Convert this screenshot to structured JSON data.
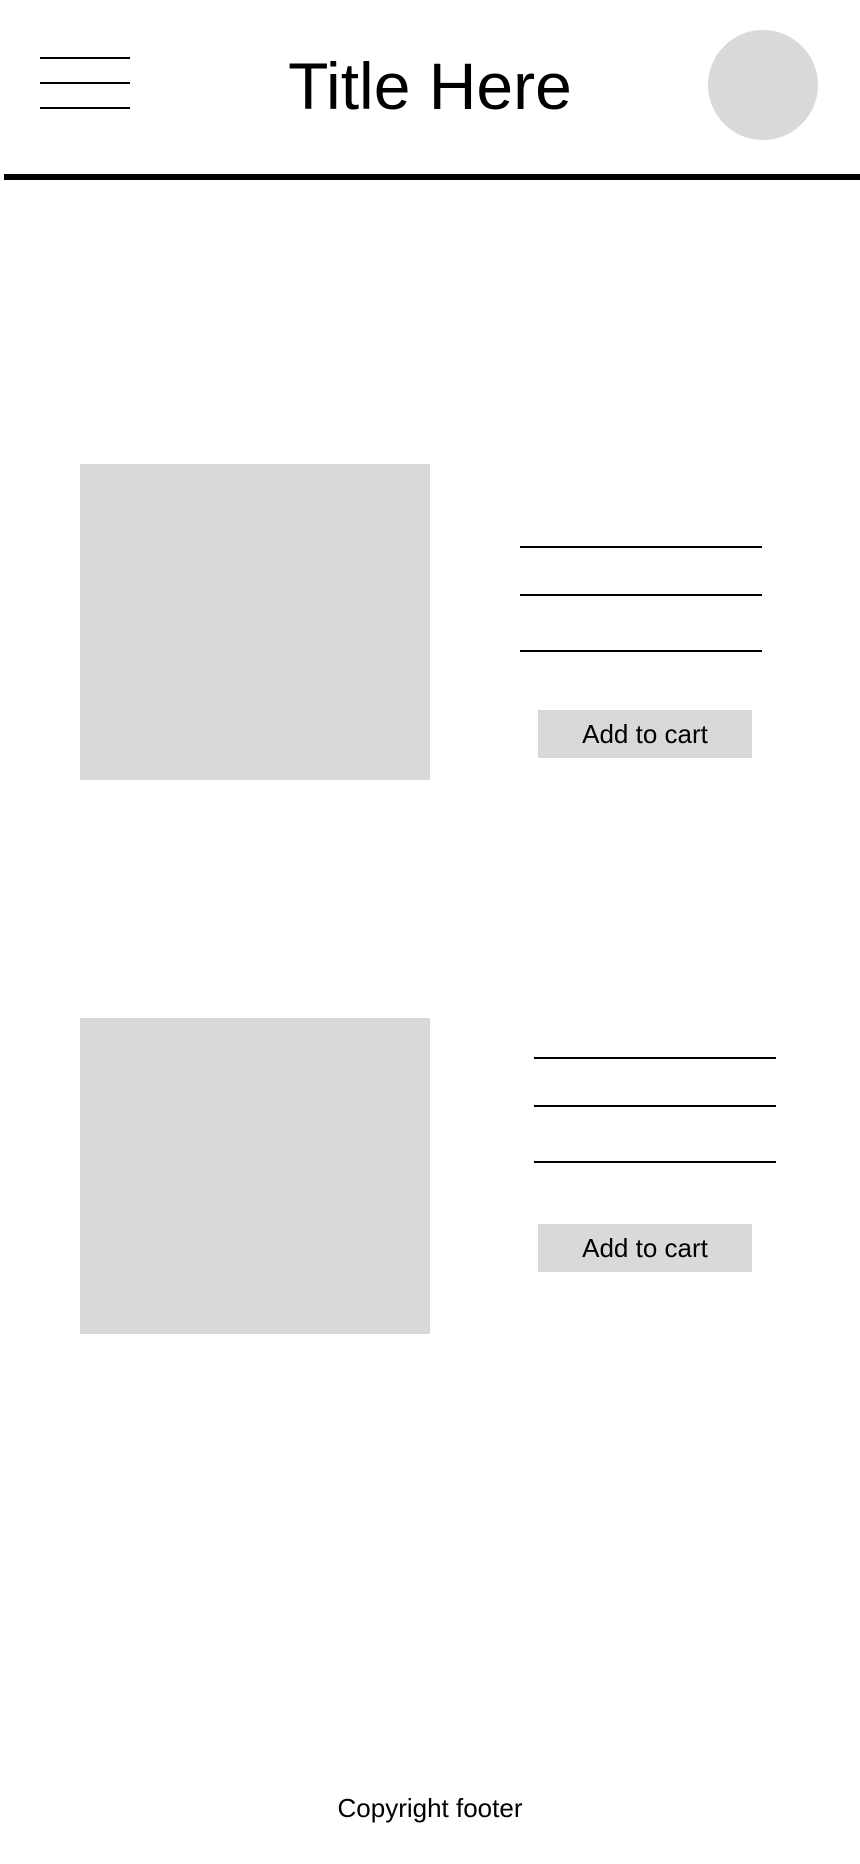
{
  "header": {
    "title": "Title Here",
    "menu_icon": "hamburger-menu-icon",
    "avatar_icon": "avatar-placeholder"
  },
  "products": [
    {
      "image": "image-placeholder",
      "add_to_cart_label": "Add to cart"
    },
    {
      "image": "image-placeholder",
      "add_to_cart_label": "Add to cart"
    }
  ],
  "footer": {
    "text": "Copyright footer"
  },
  "colors": {
    "placeholder": "#d9d9d9",
    "text": "#000000",
    "background": "#ffffff"
  }
}
